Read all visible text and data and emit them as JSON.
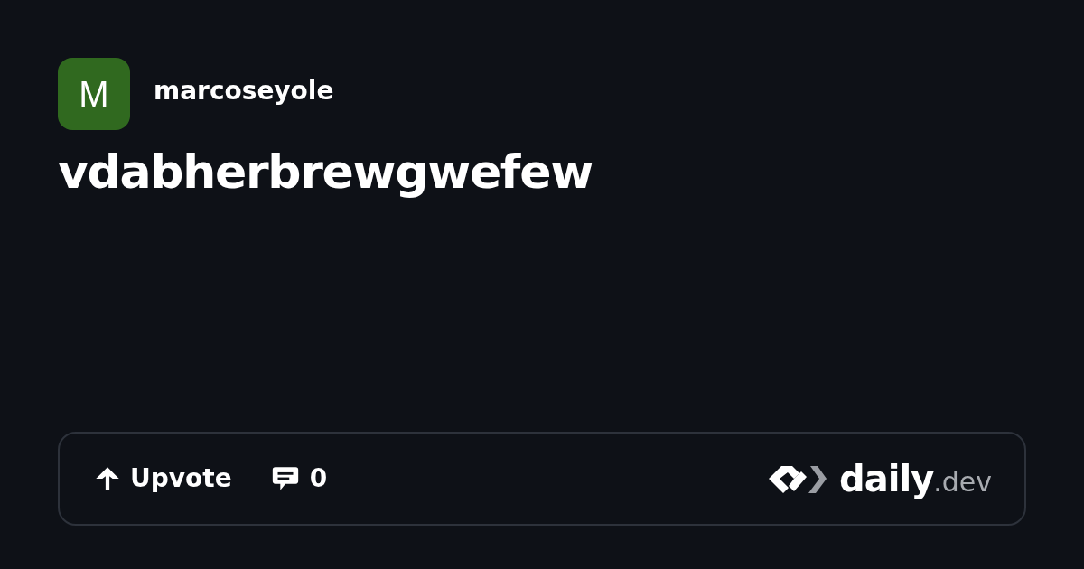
{
  "author": {
    "avatar_letter": "M",
    "name": "marcoseyole"
  },
  "title": "vdabherbrewgwefew",
  "footer": {
    "upvote": "Upvote",
    "comments": "0",
    "brand": "daily",
    "brand_suffix": ".dev"
  }
}
